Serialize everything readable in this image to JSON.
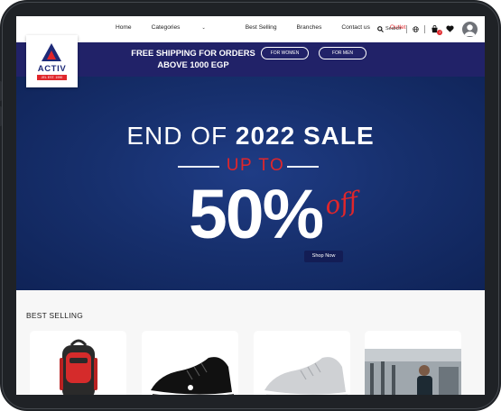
{
  "brand": {
    "name": "ACTIV",
    "tagline": "JEL EST. 1990"
  },
  "nav": {
    "home": "Home",
    "categories": "Categories",
    "best_selling": "Best Selling",
    "branches": "Branches",
    "contact": "Contact us",
    "outlet": "Outlet"
  },
  "tools": {
    "search": "Search",
    "cart_count": "2"
  },
  "promo": {
    "line1": "FREE SHIPPING FOR ORDERS",
    "line2": "ABOVE 1000 EGP",
    "for_women": "FOR WOMEN",
    "for_men": "FOR MEN"
  },
  "hero": {
    "title_pre": "END OF ",
    "title_bold": "2022 SALE",
    "up_to": "UP TO",
    "percent": "50%",
    "off": "off",
    "cta": "Shop Now"
  },
  "best_selling": {
    "title": "BEST SELLING"
  },
  "colors": {
    "brand_navy": "#212268",
    "hero_blue": "#17306e",
    "accent_red": "#e0262b"
  },
  "icons": [
    "search-icon",
    "globe-icon",
    "cart-icon",
    "heart-icon",
    "user-avatar-icon",
    "chevron-down-icon"
  ]
}
